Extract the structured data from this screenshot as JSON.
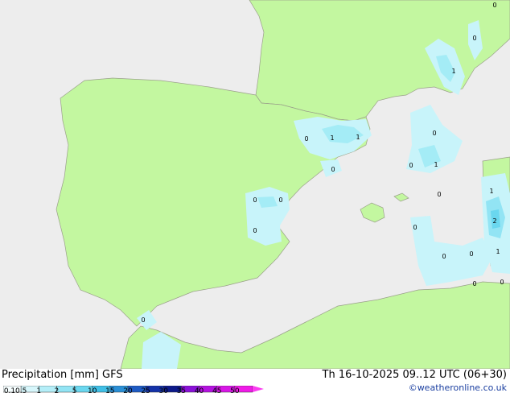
{
  "map": {
    "colors": {
      "sea": "#ededed",
      "land": "#c3f7a0",
      "border": "#9aa08a",
      "precip_light": "#c8f4fa",
      "precip_mid": "#a4ecf6"
    },
    "values": [
      "1",
      "0",
      "0",
      "1",
      "0",
      "1",
      "1",
      "0",
      "0",
      "1",
      "1",
      "0",
      "0",
      "0",
      "1",
      "2",
      "0",
      "0",
      "0",
      "1",
      "0",
      "0",
      "0",
      "0",
      "0"
    ]
  },
  "legend": {
    "title": "Precipitation [mm]  GFS",
    "ticks": [
      "0.1",
      "0.5",
      "1",
      "2",
      "5",
      "10",
      "15",
      "20",
      "25",
      "30",
      "35",
      "40",
      "45",
      "50"
    ],
    "colors": [
      "#f5fdfe",
      "#d6f6fb",
      "#b4eef8",
      "#92e4f4",
      "#6ad7ef",
      "#3fbfe6",
      "#2a8fd6",
      "#1e5bc4",
      "#1432a8",
      "#0d1a8a",
      "#8a10d8",
      "#b412e0",
      "#d816e6",
      "#f01ae8",
      "#fa3cf0"
    ]
  },
  "footer": {
    "datetime": "Th 16-10-2025 09..12 UTC (06+30)",
    "credit": "©weatheronline.co.uk"
  }
}
